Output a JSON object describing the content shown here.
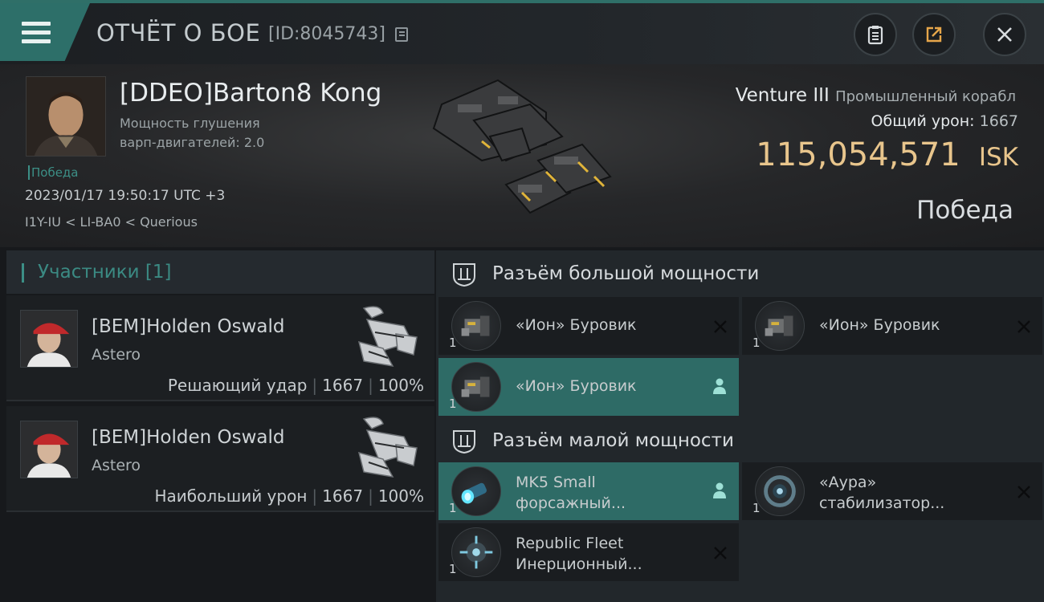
{
  "header": {
    "title": "ОТЧЁТ О БОЕ",
    "report_id": "[ID:8045743]"
  },
  "victim": {
    "name": "[DDEO]Barton8 Kong",
    "warp_line_1": "Мощность глушения",
    "warp_line_2": "варп-двигателей: 2.0",
    "result_tag": "Победа",
    "datetime": "2023/01/17 19:50:17 UTC +3",
    "location": "I1Y-IU < LI-BA0 < Querious"
  },
  "ship": {
    "name": "Venture III",
    "class": "Промышленный корабл",
    "total_damage_label": "Общий урон:",
    "total_damage": "1667",
    "isk_value": "115,054,571",
    "isk_currency": "ISK",
    "result": "Победа"
  },
  "participants": {
    "header": "Участники [1]",
    "items": [
      {
        "name": "[BEM]Holden Oswald",
        "ship": "Astero",
        "role": "Решающий удар",
        "damage": "1667",
        "percent": "100%"
      },
      {
        "name": "[BEM]Holden Oswald",
        "ship": "Astero",
        "role": "Наибольший урон",
        "damage": "1667",
        "percent": "100%"
      }
    ]
  },
  "fittings": {
    "high_slots_title": "Разъём большой мощности",
    "low_slots_title": "Разъём малой мощности",
    "high_slots": [
      {
        "name": "«Ион» Буровик",
        "qty": "1",
        "state": "destroyed"
      },
      {
        "name": "«Ион» Буровик",
        "qty": "1",
        "state": "destroyed"
      },
      {
        "name": "«Ион» Буровик",
        "qty": "1",
        "state": "dropped"
      }
    ],
    "low_slots": [
      {
        "name_1": "MK5 Small",
        "name_2": "форсажный...",
        "qty": "1",
        "state": "dropped"
      },
      {
        "name_1": "«Аура»",
        "name_2": "стабилизатор...",
        "qty": "1",
        "state": "destroyed"
      },
      {
        "name_1": "Republic Fleet",
        "name_2": "Инерционный...",
        "qty": "1",
        "state": "destroyed"
      }
    ]
  },
  "colors": {
    "accent_teal": "#2e6b66",
    "isk_gold": "#e8c58c"
  },
  "icons": [
    "menu-icon",
    "copy-icon",
    "clipboard-icon",
    "share-icon",
    "close-icon",
    "slot-high-icon",
    "slot-low-icon",
    "destroyed-x-icon",
    "pilot-icon"
  ]
}
